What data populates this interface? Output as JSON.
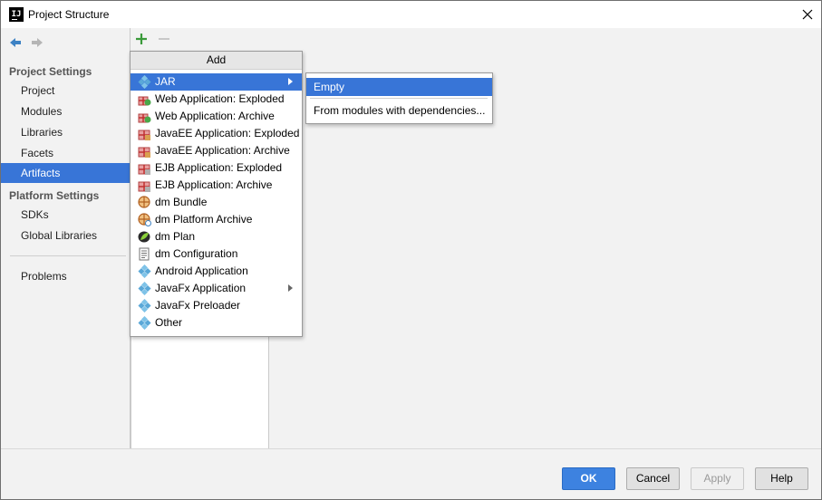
{
  "window": {
    "title": "Project Structure"
  },
  "sidebar": {
    "sections": [
      {
        "title": "Project Settings",
        "items": [
          "Project",
          "Modules",
          "Libraries",
          "Facets",
          "Artifacts"
        ]
      },
      {
        "title": "Platform Settings",
        "items": [
          "SDKs",
          "Global Libraries"
        ]
      }
    ],
    "extra_items": [
      "Problems"
    ],
    "selected": "Artifacts"
  },
  "popup": {
    "header": "Add",
    "items": [
      {
        "label": "JAR",
        "icon": "diamond-artifact-icon",
        "submenu": true,
        "selected": true
      },
      {
        "label": "Web Application: Exploded",
        "icon": "gift-box-icon"
      },
      {
        "label": "Web Application: Archive",
        "icon": "gift-box-icon"
      },
      {
        "label": "JavaEE Application: Exploded",
        "icon": "gift-box-icon"
      },
      {
        "label": "JavaEE Application: Archive",
        "icon": "gift-box-icon"
      },
      {
        "label": "EJB Application: Exploded",
        "icon": "gift-box-icon"
      },
      {
        "label": "EJB Application: Archive",
        "icon": "gift-box-icon"
      },
      {
        "label": "dm Bundle",
        "icon": "bundle-wheel-icon"
      },
      {
        "label": "dm Platform Archive",
        "icon": "bundle-wheel-icon"
      },
      {
        "label": "dm Plan",
        "icon": "plan-leaf-icon"
      },
      {
        "label": "dm Configuration",
        "icon": "config-file-icon"
      },
      {
        "label": "Android Application",
        "icon": "diamond-artifact-icon"
      },
      {
        "label": "JavaFx Application",
        "icon": "diamond-artifact-icon",
        "submenu": true
      },
      {
        "label": "JavaFx Preloader",
        "icon": "diamond-artifact-icon"
      },
      {
        "label": "Other",
        "icon": "diamond-artifact-icon"
      }
    ]
  },
  "submenu": {
    "items": [
      "Empty",
      "From modules with dependencies..."
    ],
    "selected": "Empty"
  },
  "buttons": {
    "ok": "OK",
    "cancel": "Cancel",
    "apply": "Apply",
    "help": "Help"
  },
  "colors": {
    "selection": "#3875d7",
    "ok_button": "#3d82e0",
    "add_icon": "#3a9a3a"
  }
}
